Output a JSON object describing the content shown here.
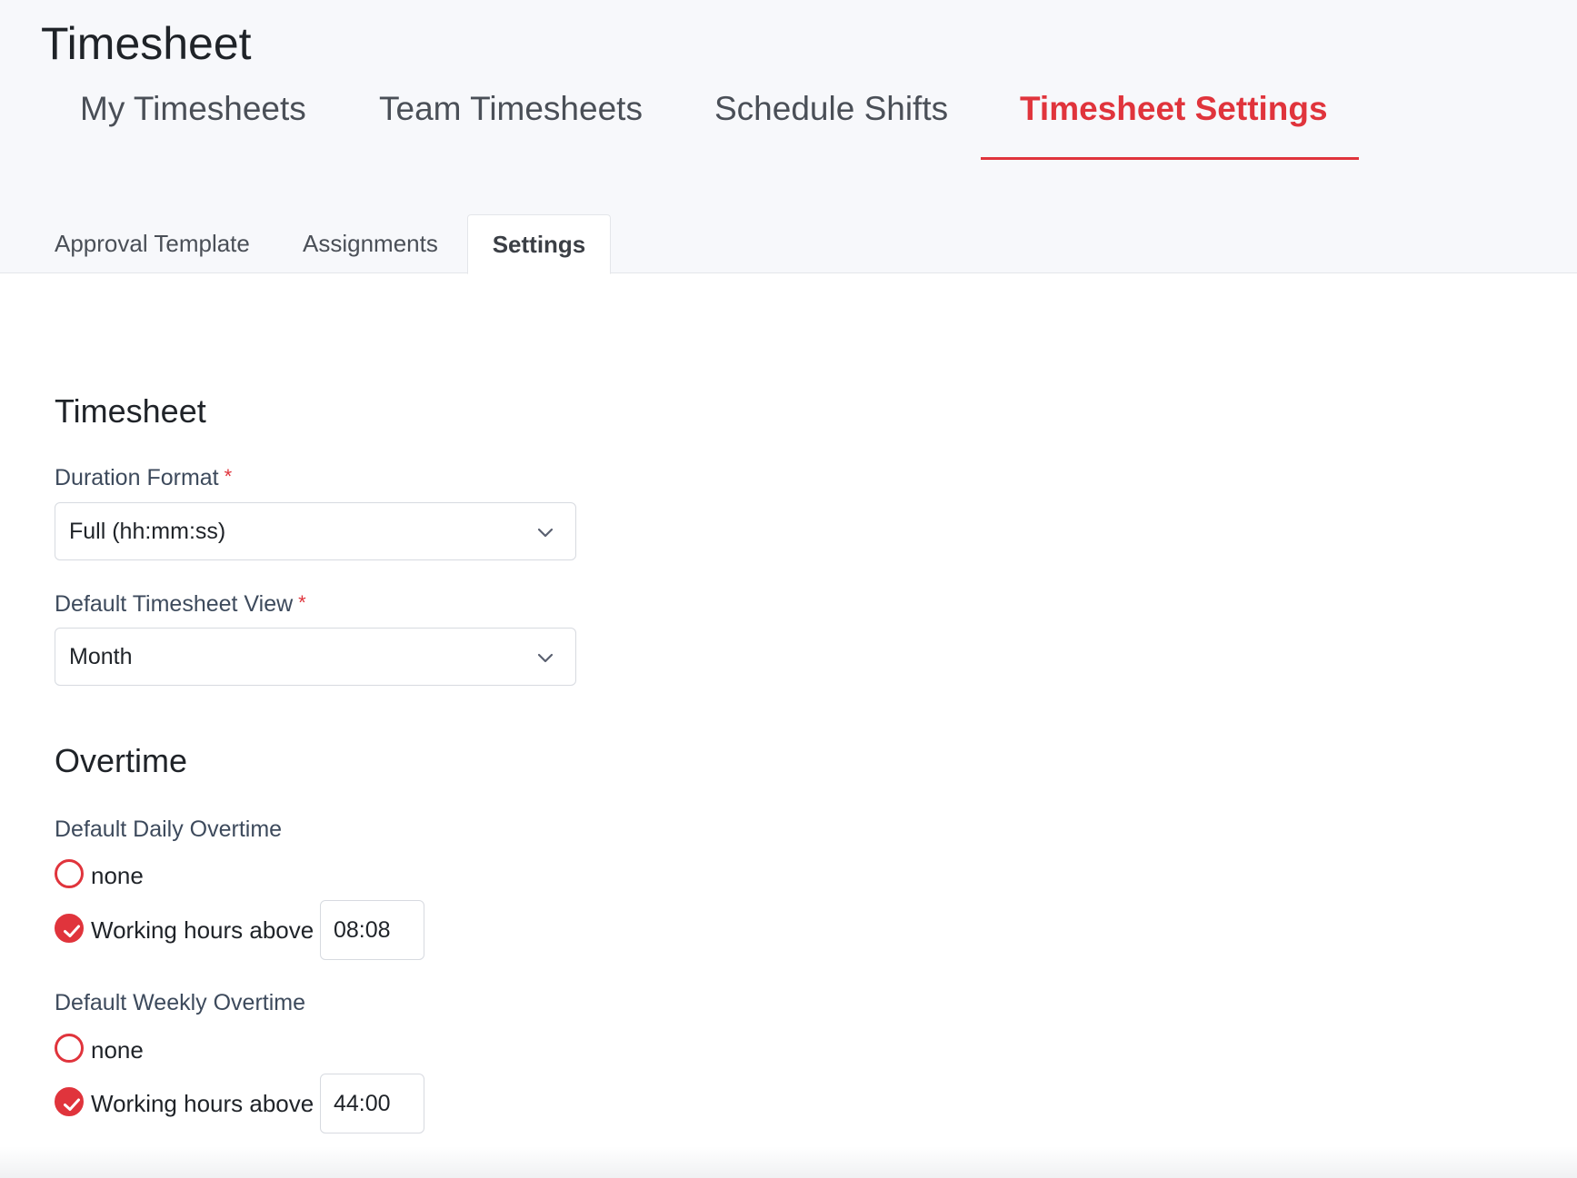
{
  "app": {
    "title": "Timesheet"
  },
  "main_tabs": [
    {
      "label": "My Timesheets",
      "active": false
    },
    {
      "label": "Team Timesheets",
      "active": false
    },
    {
      "label": "Schedule Shifts",
      "active": false
    },
    {
      "label": "Timesheet Settings",
      "active": true
    }
  ],
  "sub_tabs": [
    {
      "label": "Approval Template",
      "active": false
    },
    {
      "label": "Assignments",
      "active": false
    },
    {
      "label": "Settings",
      "active": true
    }
  ],
  "timesheet_section": {
    "heading": "Timesheet",
    "duration_format": {
      "label": "Duration Format",
      "required_mark": "*",
      "value": "Full (hh:mm:ss)",
      "icon": "chevron-down-icon"
    },
    "default_view": {
      "label": "Default Timesheet View",
      "required_mark": "*",
      "value": "Month",
      "icon": "chevron-down-icon"
    }
  },
  "overtime_section": {
    "heading": "Overtime",
    "daily": {
      "label": "Default Daily Overtime",
      "option_none": "none",
      "option_above": "Working hours above",
      "selected": "above",
      "value": "08:08"
    },
    "weekly": {
      "label": "Default Weekly Overtime",
      "option_none": "none",
      "option_above": "Working hours above",
      "selected": "above",
      "value": "44:00"
    }
  },
  "colors": {
    "accent": "#e0343c",
    "header_bg": "#f7f8fb",
    "label": "#3d4a5c"
  }
}
